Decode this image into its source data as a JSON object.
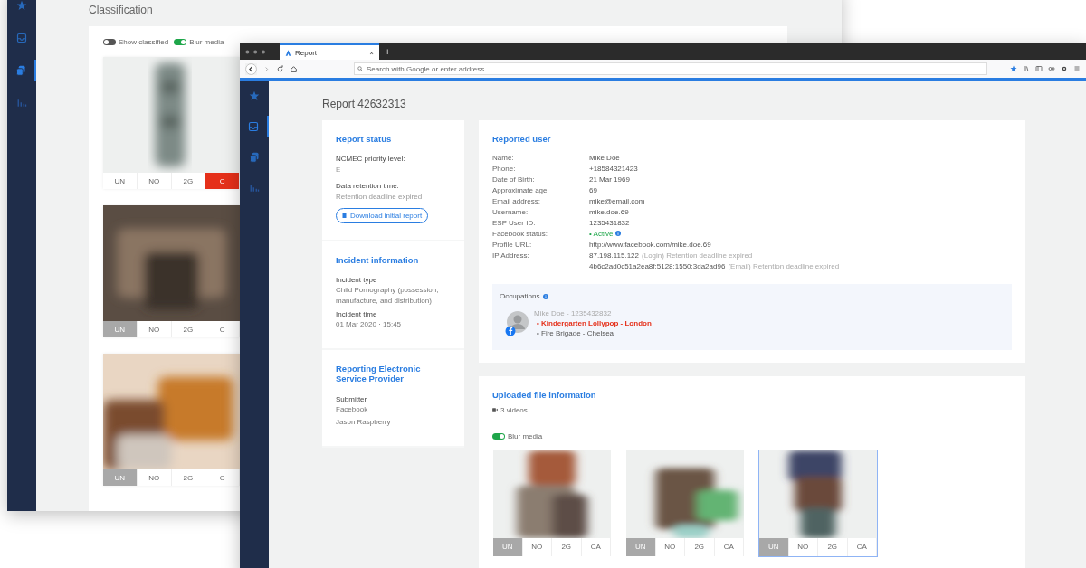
{
  "back_window": {
    "sidebar": [
      {
        "kind": "star",
        "selected": false
      },
      {
        "kind": "inbox",
        "selected": false
      },
      {
        "kind": "layers",
        "selected": true
      },
      {
        "kind": "chart",
        "selected": false
      }
    ],
    "title": "Classification",
    "toggles": [
      {
        "label": "Show classified",
        "on": false
      },
      {
        "label": "Blur media",
        "on": true
      }
    ],
    "media": [
      {
        "kind": "picture",
        "flagged": true,
        "classes": [
          {
            "label": "UN",
            "selected": false
          },
          {
            "label": "NO",
            "selected": false
          },
          {
            "label": "2G",
            "selected": false
          },
          {
            "label": "C",
            "selected": true
          }
        ]
      },
      {
        "kind": "picture",
        "flagged": false,
        "classes": [
          {
            "label": "UN",
            "selected": true
          },
          {
            "label": "NO",
            "selected": false
          },
          {
            "label": "2G",
            "selected": false
          },
          {
            "label": "C",
            "selected": false
          }
        ]
      },
      {
        "kind": "picture",
        "flagged": false,
        "classes": [
          {
            "label": "UN",
            "selected": true
          },
          {
            "label": "NO",
            "selected": false
          },
          {
            "label": "2G",
            "selected": false
          },
          {
            "label": "C",
            "selected": false
          }
        ]
      }
    ]
  },
  "browser": {
    "tabs": [
      {
        "label": "Report",
        "close": "×",
        "selected": true
      }
    ],
    "new_tab": "+",
    "address": {
      "placeholder": "Search with Google or enter address"
    }
  },
  "sidebar": [
    {
      "kind": "star",
      "selected": false
    },
    {
      "kind": "inbox",
      "selected": true
    },
    {
      "kind": "layers",
      "selected": false
    },
    {
      "kind": "chart",
      "selected": false
    }
  ],
  "page_title": "Report 42632313",
  "report_status": {
    "title": "Report status",
    "fields": [
      {
        "label": "NCMEC priority level:",
        "value": "E"
      },
      {
        "label": "Data retention time:",
        "value": "Retention deadline expired"
      }
    ],
    "button": "Download initial report"
  },
  "incident": {
    "title": "Incident information",
    "fields": [
      {
        "label": "Incident type",
        "value": "Child Pornography (possession, manufacture, and distribution)"
      },
      {
        "label": "Incident time",
        "value": "01 Mar 2020 · 15:45"
      }
    ]
  },
  "esp": {
    "title": "Reporting Electronic Service Provider",
    "fields": [
      {
        "label": "Submitter",
        "value": "Facebook"
      },
      {
        "value": "Jason Raspberry"
      }
    ]
  },
  "reported_user": {
    "title": "Reported user",
    "rows": [
      {
        "label": "Name:",
        "values": [
          {
            "text": "Mike Doe",
            "kind": "plain"
          }
        ]
      },
      {
        "label": "Phone:",
        "values": [
          {
            "text": "+18584321423",
            "kind": "plain"
          }
        ]
      },
      {
        "label": "Date of Birth:",
        "values": [
          {
            "text": "21 Mar 1969",
            "kind": "plain"
          }
        ]
      },
      {
        "label": "Approximate age:",
        "values": [
          {
            "text": "69",
            "kind": "plain"
          }
        ]
      },
      {
        "label": "Email address:",
        "values": [
          {
            "text": "mike@email.com",
            "kind": "plain"
          }
        ]
      },
      {
        "label": "Username:",
        "values": [
          {
            "text": "mike.doe.69",
            "kind": "plain"
          }
        ]
      },
      {
        "label": "ESP User ID:",
        "values": [
          {
            "text": "1235431832",
            "kind": "plain"
          }
        ]
      },
      {
        "label": "Facebook status:",
        "values": [
          {
            "text": "• Active",
            "kind": "status"
          }
        ]
      },
      {
        "label": "Profile URL:",
        "values": [
          {
            "text": "http://www.facebook.com/mike.doe.69",
            "kind": "plain"
          }
        ]
      },
      {
        "label": "IP Address:",
        "values": [
          {
            "text": "87.198.115.122",
            "kind": "plain"
          },
          {
            "text": "(Login) Retention deadline expired",
            "kind": "note"
          }
        ]
      },
      {
        "values": [
          {
            "text": "4b6c2ad0c51a2ea8f:5128:1550:3da2ad96",
            "kind": "plain"
          },
          {
            "text": "(Email) Retention deadline expired",
            "kind": "note"
          }
        ]
      }
    ],
    "occupations": {
      "title": "Occupations",
      "person": "Mike Doe - 1235432832",
      "items": [
        {
          "text": "• Kindergarten Lollypop - London",
          "flagged": true
        },
        {
          "text": "• Fire Brigade - Chelsea",
          "flagged": false
        }
      ]
    }
  },
  "uploaded": {
    "title": "Uploaded file information",
    "count": "3 videos",
    "toggle": {
      "label": "Blur media",
      "on": true
    },
    "media": [
      {
        "kind": "picture",
        "selected": false,
        "classes": [
          {
            "label": "UN",
            "selected": true
          },
          {
            "label": "NO",
            "selected": false
          },
          {
            "label": "2G",
            "selected": false
          },
          {
            "label": "CA",
            "selected": false
          }
        ]
      },
      {
        "kind": "picture",
        "selected": false,
        "classes": [
          {
            "label": "UN",
            "selected": true
          },
          {
            "label": "NO",
            "selected": false
          },
          {
            "label": "2G",
            "selected": false
          },
          {
            "label": "CA",
            "selected": false
          }
        ]
      },
      {
        "kind": "picture",
        "selected": true,
        "classes": [
          {
            "label": "UN",
            "selected": true
          },
          {
            "label": "NO",
            "selected": false
          },
          {
            "label": "2G",
            "selected": false
          },
          {
            "label": "CA",
            "selected": false
          }
        ]
      }
    ]
  }
}
